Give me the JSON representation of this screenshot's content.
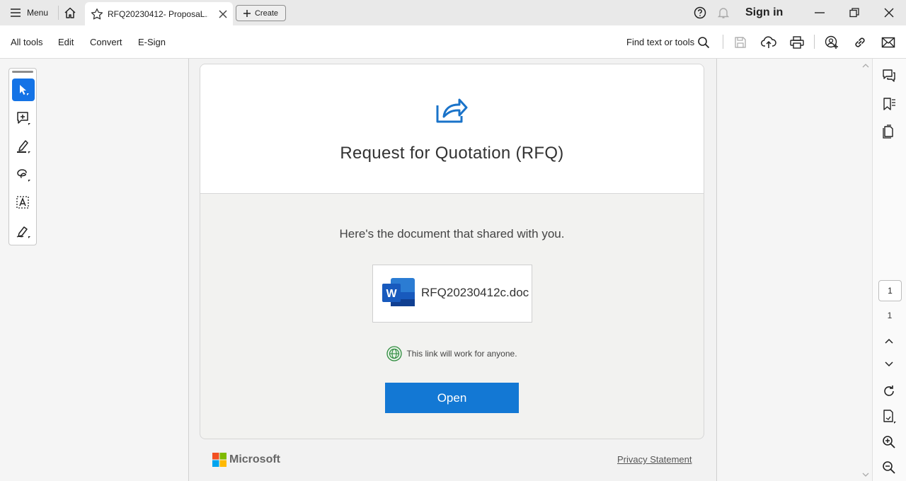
{
  "titlebar": {
    "menu_label": "Menu",
    "tab_title": "RFQ20230412- ProposaL...",
    "create_label": "Create",
    "sign_in_label": "Sign in"
  },
  "toolbar": {
    "items": [
      "All tools",
      "Edit",
      "Convert",
      "E-Sign"
    ],
    "find_label": "Find text or tools"
  },
  "document": {
    "title": "Request for Quotation (RFQ)",
    "message": "Here's the document that shared with you.",
    "file_name": "RFQ20230412c.doc",
    "file_icon_letter": "W",
    "link_note": "This link will work for anyone.",
    "open_label": "Open",
    "brand": "Microsoft",
    "privacy_label": "Privacy Statement"
  },
  "page_nav": {
    "current_page": "1",
    "total_pages": "1"
  },
  "colors": {
    "accent": "#1473e6",
    "open_button": "#1378d4",
    "word_blue": "#185abd"
  }
}
